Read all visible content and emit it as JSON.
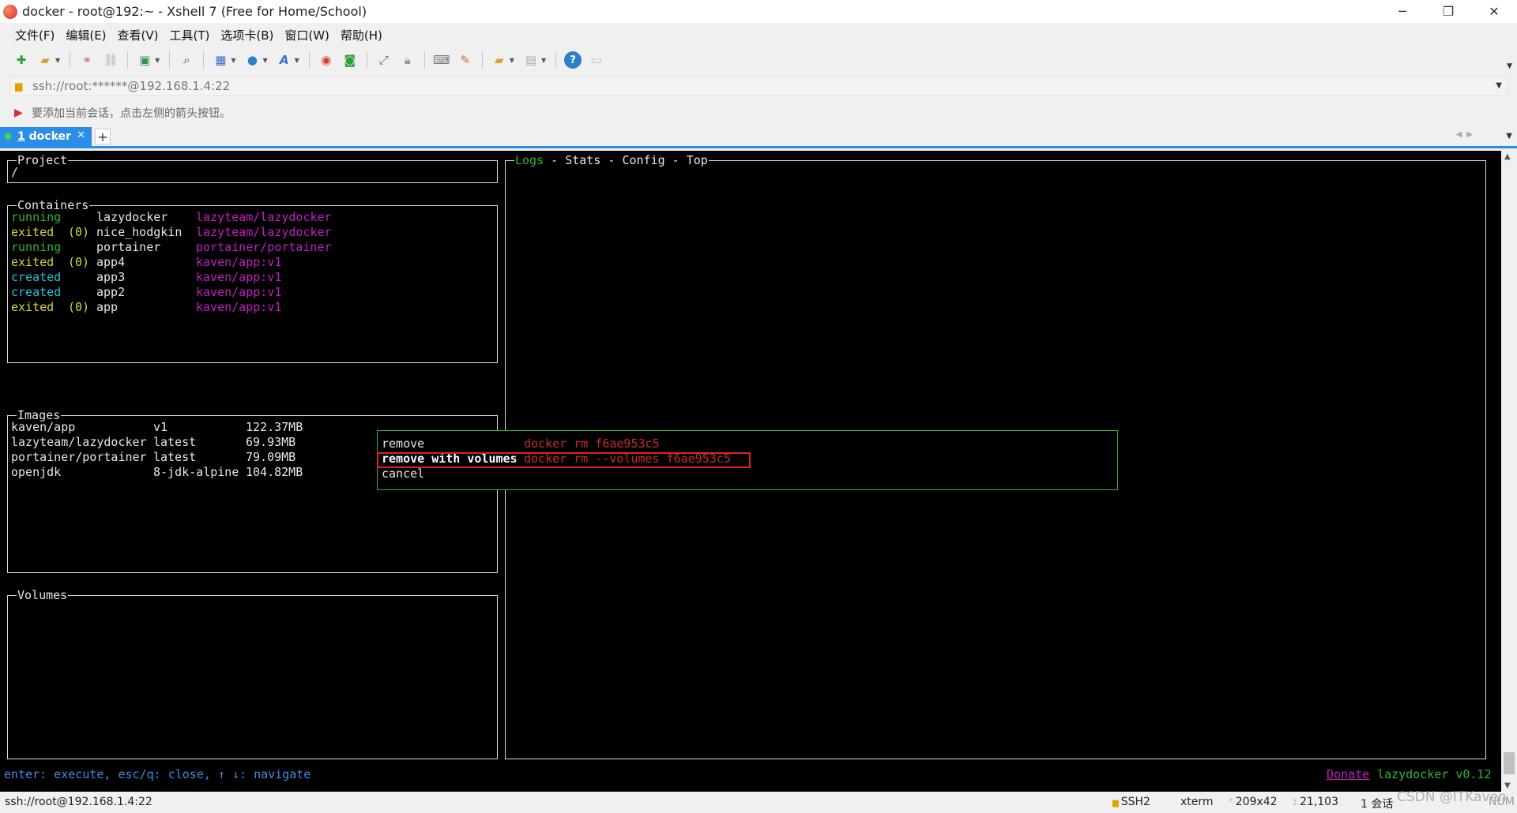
{
  "window": {
    "title": "docker - root@192:~ - Xshell 7 (Free for Home/School)",
    "controls": [
      "─",
      "❐",
      "✕"
    ]
  },
  "menu": [
    "文件(F)",
    "编辑(E)",
    "查看(V)",
    "工具(T)",
    "选项卡(B)",
    "窗口(W)",
    "帮助(H)"
  ],
  "address": {
    "value": "ssh://root:******@192.168.1.4:22"
  },
  "hint": "要添加当前会话，点击左侧的箭头按钮。",
  "tab": {
    "index": "1",
    "label": " docker"
  },
  "terminal": {
    "project": {
      "title": "Project",
      "path": "/"
    },
    "containers": {
      "title": "Containers",
      "rows": [
        {
          "status": "running",
          "code": "",
          "name": "lazydocker",
          "image": "lazyteam/lazydocker"
        },
        {
          "status": "exited",
          "code": "(0)",
          "name": "nice_hodgkin",
          "image": "lazyteam/lazydocker"
        },
        {
          "status": "running",
          "code": "",
          "name": "portainer",
          "image": "portainer/portainer"
        },
        {
          "status": "exited",
          "code": "(0)",
          "name": "app4",
          "image": "kaven/app:v1"
        },
        {
          "status": "created",
          "code": "",
          "name": "app3",
          "image": "kaven/app:v1"
        },
        {
          "status": "created",
          "code": "",
          "name": "app2",
          "image": "kaven/app:v1"
        },
        {
          "status": "exited",
          "code": "(0)",
          "name": "app",
          "image": "kaven/app:v1"
        }
      ]
    },
    "images": {
      "title": "Images",
      "rows": [
        {
          "name": "kaven/app",
          "tag": "v1",
          "size": "122.37MB"
        },
        {
          "name": "lazyteam/lazydocker",
          "tag": "latest",
          "size": "69.93MB"
        },
        {
          "name": "portainer/portainer",
          "tag": "latest",
          "size": "79.09MB"
        },
        {
          "name": "openjdk",
          "tag": "8-jdk-alpine",
          "size": "104.82MB"
        }
      ]
    },
    "volumes": {
      "title": "Volumes"
    },
    "right_tabs": {
      "logs": "Logs",
      "sep": " - ",
      "stats": "Stats",
      "config": "Config",
      "top": "Top"
    },
    "popup": {
      "items": [
        {
          "label": "remove",
          "command": "docker rm f6ae953c5"
        },
        {
          "label": "remove with volumes",
          "command": "docker rm --volumes f6ae953c5"
        },
        {
          "label": "cancel",
          "command": ""
        }
      ]
    },
    "footer": {
      "keys": "enter: execute, esc/q: close, ↑ ↓: navigate",
      "donate": "Donate",
      "version": "lazydocker v0.12"
    }
  },
  "status": {
    "connection": "ssh://root@192.168.1.4:22",
    "protocol": "SSH2",
    "term": "xterm",
    "size": "209x42",
    "cursor": "21,103",
    "sessions": "1 会话",
    "extra": "NUM"
  },
  "watermark": "CSDN @ITKaven",
  "colors": {
    "accent": "#2a8ee6",
    "running": "#2fb62f",
    "exited": "#d6d637",
    "created": "#23c5d8",
    "image": "#c51cc5",
    "command": "#c82a2a",
    "highlight": "#e02020"
  }
}
